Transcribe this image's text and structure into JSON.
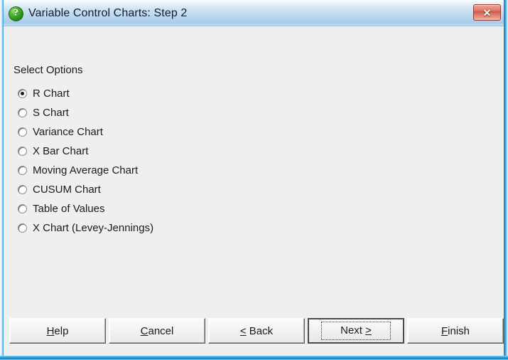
{
  "window": {
    "title": "Variable Control Charts: Step 2",
    "icon": "question-mark-icon",
    "close_label": "✕",
    "accent_frame_color": "#1b8fd1",
    "titlebar_color": "#bed9ef",
    "body_color": "#efefee"
  },
  "content": {
    "group_label": "Select Options",
    "options": [
      {
        "label": "R Chart",
        "selected": true
      },
      {
        "label": "S Chart",
        "selected": false
      },
      {
        "label": "Variance Chart",
        "selected": false
      },
      {
        "label": "X Bar Chart",
        "selected": false
      },
      {
        "label": "Moving Average Chart",
        "selected": false
      },
      {
        "label": "CUSUM Chart",
        "selected": false
      },
      {
        "label": "Table of Values",
        "selected": false
      },
      {
        "label": "X Chart (Levey-Jennings)",
        "selected": false
      }
    ]
  },
  "buttons": {
    "help": {
      "pre": "",
      "key": "H",
      "post": "elp"
    },
    "cancel": {
      "pre": "",
      "key": "C",
      "post": "ancel"
    },
    "back": {
      "pre": "",
      "key": "<",
      "post": " Back"
    },
    "next": {
      "pre": "Next ",
      "key": ">",
      "post": ""
    },
    "finish": {
      "pre": "",
      "key": "F",
      "post": "inish"
    }
  }
}
